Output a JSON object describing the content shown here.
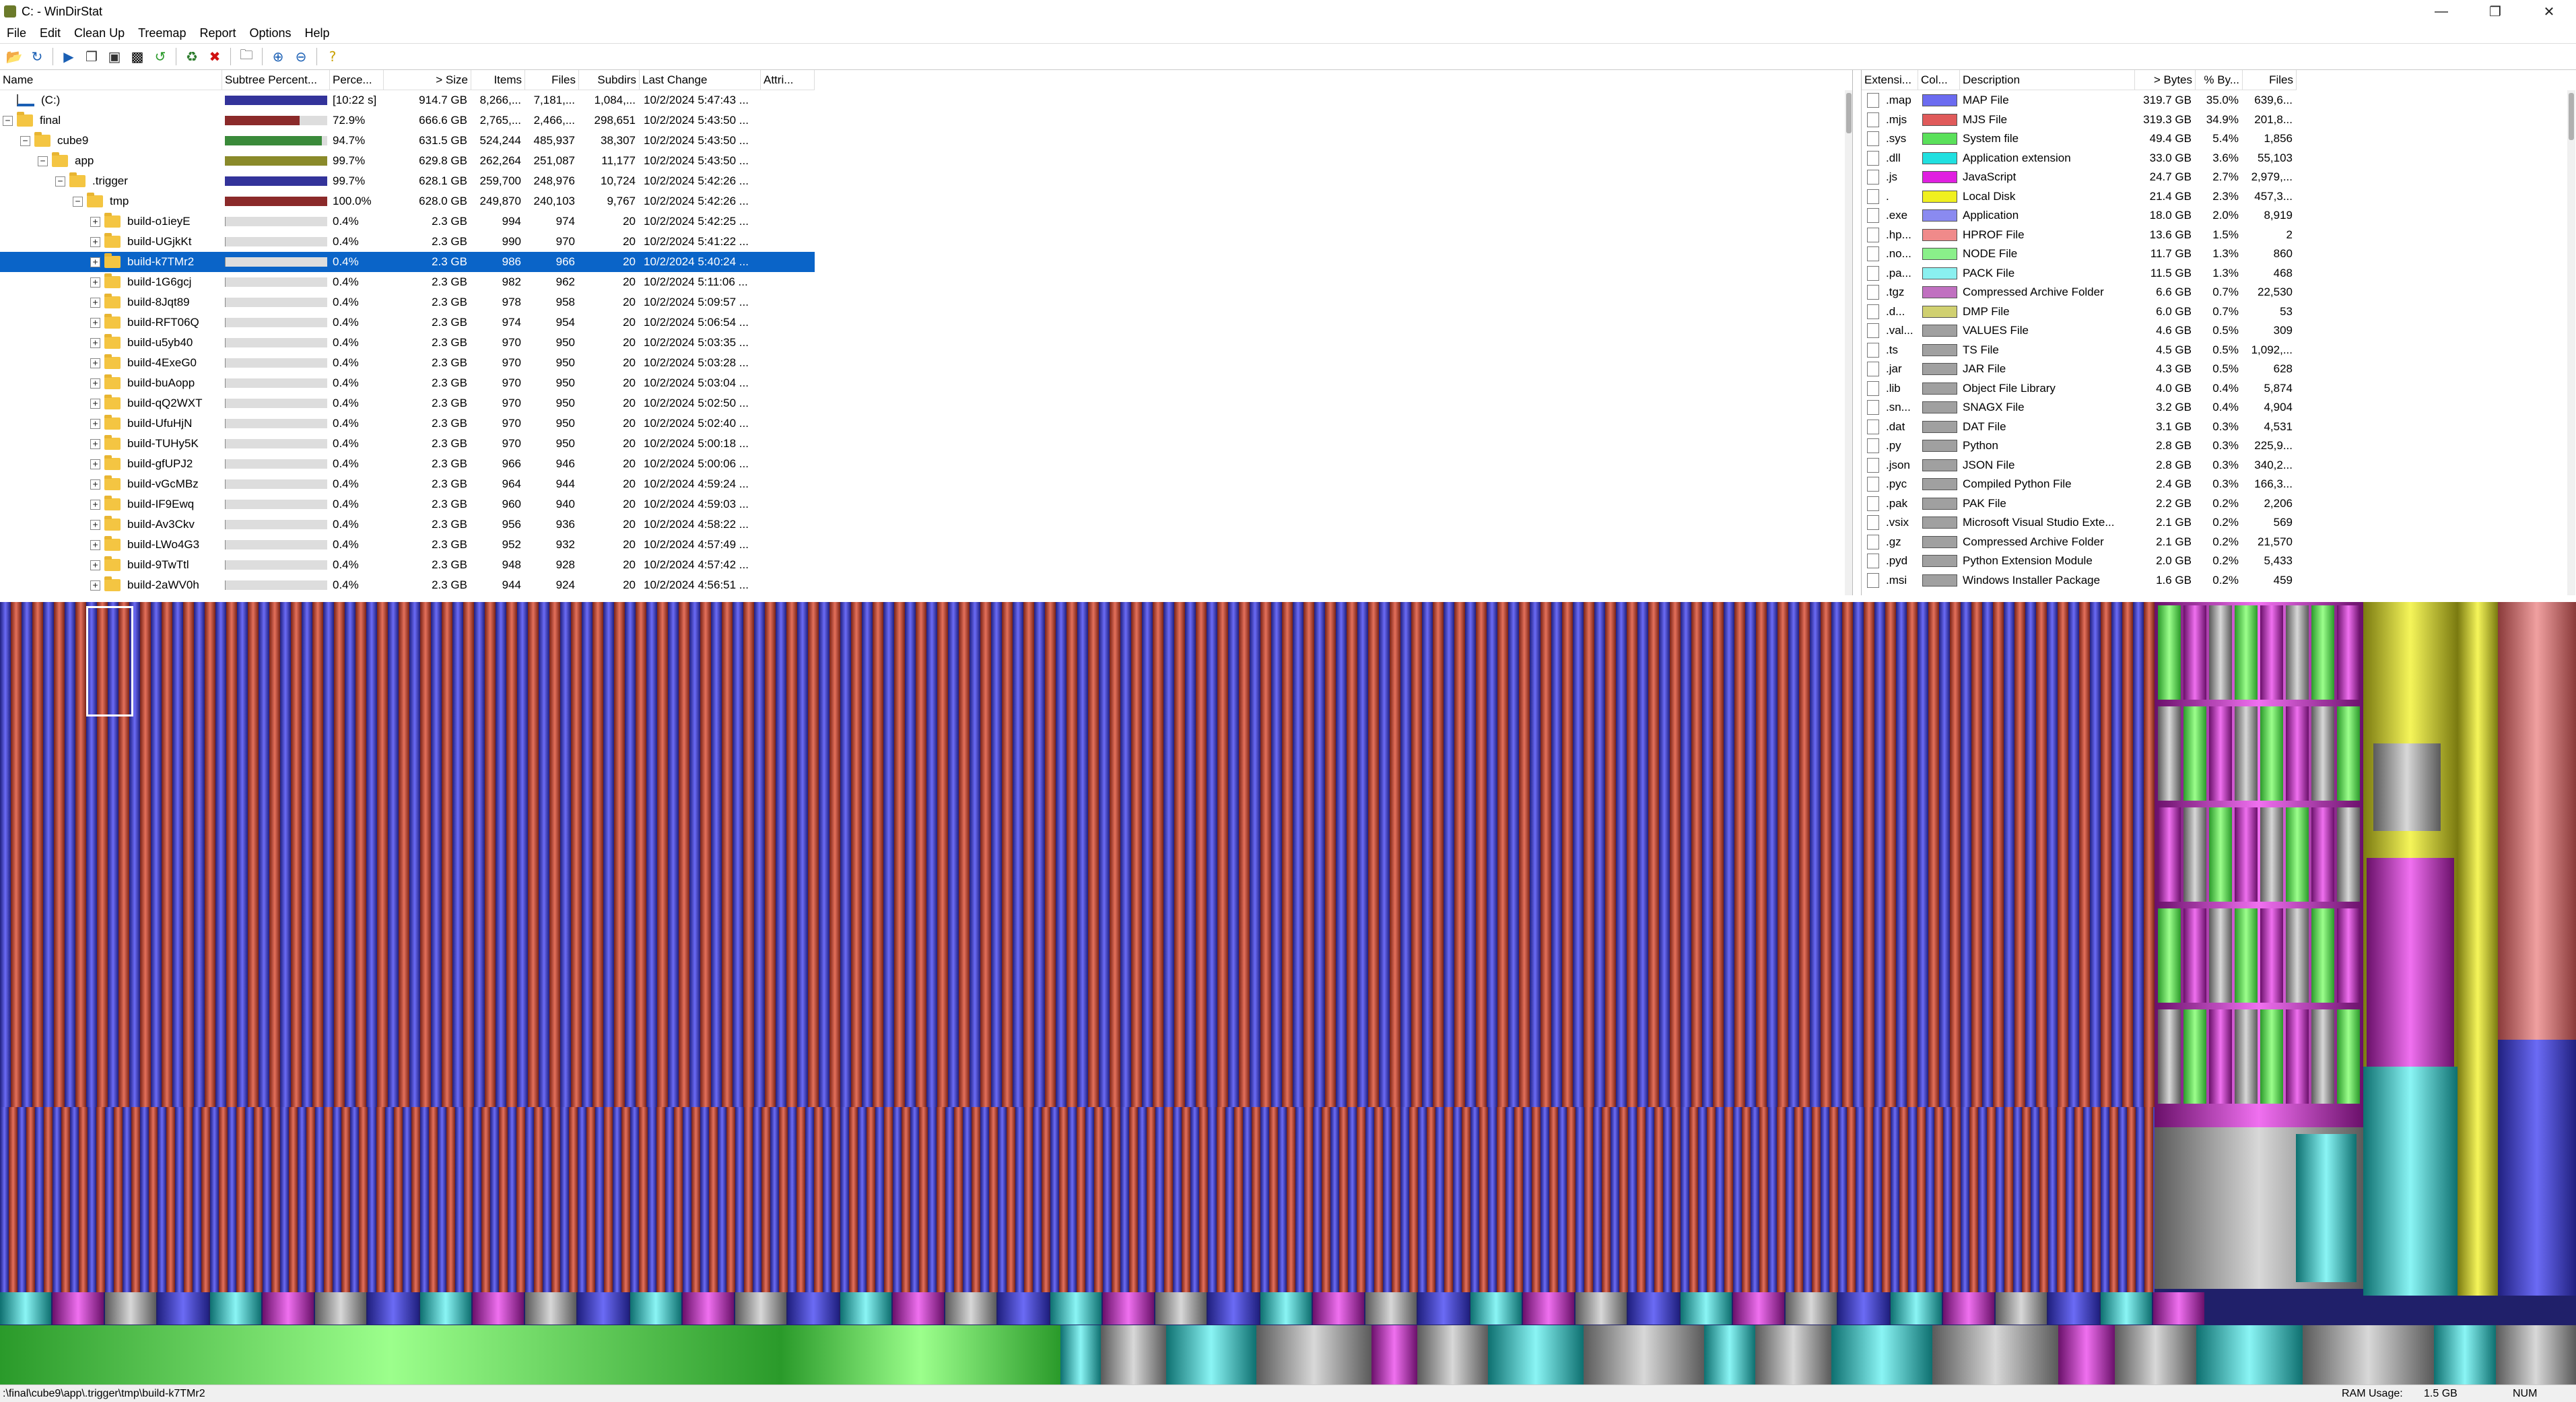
{
  "window": {
    "title": "C: - WinDirStat",
    "controls": {
      "minimize": "—",
      "maximize": "❐",
      "close": "✕"
    }
  },
  "menu": [
    "File",
    "Edit",
    "Clean Up",
    "Treemap",
    "Report",
    "Options",
    "Help"
  ],
  "toolbar": {
    "icons": [
      "open-icon",
      "refresh-icon",
      "play-icon",
      "copy-path-icon",
      "explorer-icon",
      "command-prompt-icon",
      "refresh-selected-icon",
      "recycle-icon",
      "delete-icon",
      "properties-icon",
      "zoom-in-icon",
      "zoom-out-icon",
      "help-icon"
    ]
  },
  "tree": {
    "columns": [
      "Name",
      "Subtree Percent...",
      "Perce...",
      "> Size",
      "Items",
      "Files",
      "Subdirs",
      "Last Change",
      "Attri..."
    ],
    "rows": [
      {
        "name": "(C:)",
        "level": 0,
        "icon": "drive",
        "exp": "",
        "pct": "[10:22 s]",
        "size": "914.7 GB",
        "items": "8,266,...",
        "files": "7,181,...",
        "subdirs": "1,084,...",
        "changed": "10/2/2024  5:47:43 ...",
        "bar": 1.0,
        "barcolor": "#33339a"
      },
      {
        "name": "final",
        "level": 0,
        "icon": "folder",
        "exp": "−",
        "pct": "72.9%",
        "size": "666.6 GB",
        "items": "2,765,...",
        "files": "2,466,...",
        "subdirs": "298,651",
        "changed": "10/2/2024  5:43:50 ...",
        "bar": 0.729,
        "barcolor": "#8b2a2a"
      },
      {
        "name": "cube9",
        "level": 1,
        "icon": "folder",
        "exp": "−",
        "pct": "94.7%",
        "size": "631.5 GB",
        "items": "524,244",
        "files": "485,937",
        "subdirs": "38,307",
        "changed": "10/2/2024  5:43:50 ...",
        "bar": 0.947,
        "barcolor": "#3a8a3a"
      },
      {
        "name": "app",
        "level": 2,
        "icon": "folder",
        "exp": "−",
        "pct": "99.7%",
        "size": "629.8 GB",
        "items": "262,264",
        "files": "251,087",
        "subdirs": "11,177",
        "changed": "10/2/2024  5:43:50 ...",
        "bar": 0.997,
        "barcolor": "#8a8a2a"
      },
      {
        "name": ".trigger",
        "level": 3,
        "icon": "folder",
        "exp": "−",
        "pct": "99.7%",
        "size": "628.1 GB",
        "items": "259,700",
        "files": "248,976",
        "subdirs": "10,724",
        "changed": "10/2/2024  5:42:26 ...",
        "bar": 0.997,
        "barcolor": "#33339a"
      },
      {
        "name": "tmp",
        "level": 4,
        "icon": "folder",
        "exp": "−",
        "pct": "100.0%",
        "size": "628.0 GB",
        "items": "249,870",
        "files": "240,103",
        "subdirs": "9,767",
        "changed": "10/2/2024  5:42:26 ...",
        "bar": 1.0,
        "barcolor": "#8b2a2a"
      },
      {
        "name": "build-o1ieyE",
        "level": 5,
        "icon": "folder",
        "exp": "+",
        "pct": "0.4%",
        "size": "2.3 GB",
        "items": "994",
        "files": "974",
        "subdirs": "20",
        "changed": "10/2/2024  5:42:25 ...",
        "bar": 0.004,
        "barcolor": "#888"
      },
      {
        "name": "build-UGjkKt",
        "level": 5,
        "icon": "folder",
        "exp": "+",
        "pct": "0.4%",
        "size": "2.3 GB",
        "items": "990",
        "files": "970",
        "subdirs": "20",
        "changed": "10/2/2024  5:41:22 ...",
        "bar": 0.004,
        "barcolor": "#888"
      },
      {
        "name": "build-k7TMr2",
        "level": 5,
        "icon": "folder",
        "exp": "+",
        "pct": "0.4%",
        "size": "2.3 GB",
        "items": "986",
        "files": "966",
        "subdirs": "20",
        "changed": "10/2/2024  5:40:24 ...",
        "bar": 0.004,
        "barcolor": "#888",
        "selected": true
      },
      {
        "name": "build-1G6gcj",
        "level": 5,
        "icon": "folder",
        "exp": "+",
        "pct": "0.4%",
        "size": "2.3 GB",
        "items": "982",
        "files": "962",
        "subdirs": "20",
        "changed": "10/2/2024  5:11:06 ...",
        "bar": 0.004,
        "barcolor": "#888"
      },
      {
        "name": "build-8Jqt89",
        "level": 5,
        "icon": "folder",
        "exp": "+",
        "pct": "0.4%",
        "size": "2.3 GB",
        "items": "978",
        "files": "958",
        "subdirs": "20",
        "changed": "10/2/2024  5:09:57 ...",
        "bar": 0.004,
        "barcolor": "#888"
      },
      {
        "name": "build-RFT06Q",
        "level": 5,
        "icon": "folder",
        "exp": "+",
        "pct": "0.4%",
        "size": "2.3 GB",
        "items": "974",
        "files": "954",
        "subdirs": "20",
        "changed": "10/2/2024  5:06:54 ...",
        "bar": 0.004,
        "barcolor": "#888"
      },
      {
        "name": "build-u5yb40",
        "level": 5,
        "icon": "folder",
        "exp": "+",
        "pct": "0.4%",
        "size": "2.3 GB",
        "items": "970",
        "files": "950",
        "subdirs": "20",
        "changed": "10/2/2024  5:03:35 ...",
        "bar": 0.004,
        "barcolor": "#888"
      },
      {
        "name": "build-4ExeG0",
        "level": 5,
        "icon": "folder",
        "exp": "+",
        "pct": "0.4%",
        "size": "2.3 GB",
        "items": "970",
        "files": "950",
        "subdirs": "20",
        "changed": "10/2/2024  5:03:28 ...",
        "bar": 0.004,
        "barcolor": "#888"
      },
      {
        "name": "build-buAopp",
        "level": 5,
        "icon": "folder",
        "exp": "+",
        "pct": "0.4%",
        "size": "2.3 GB",
        "items": "970",
        "files": "950",
        "subdirs": "20",
        "changed": "10/2/2024  5:03:04 ...",
        "bar": 0.004,
        "barcolor": "#888"
      },
      {
        "name": "build-qQ2WXT",
        "level": 5,
        "icon": "folder",
        "exp": "+",
        "pct": "0.4%",
        "size": "2.3 GB",
        "items": "970",
        "files": "950",
        "subdirs": "20",
        "changed": "10/2/2024  5:02:50 ...",
        "bar": 0.004,
        "barcolor": "#888"
      },
      {
        "name": "build-UfuHjN",
        "level": 5,
        "icon": "folder",
        "exp": "+",
        "pct": "0.4%",
        "size": "2.3 GB",
        "items": "970",
        "files": "950",
        "subdirs": "20",
        "changed": "10/2/2024  5:02:40 ...",
        "bar": 0.004,
        "barcolor": "#888"
      },
      {
        "name": "build-TUHy5K",
        "level": 5,
        "icon": "folder",
        "exp": "+",
        "pct": "0.4%",
        "size": "2.3 GB",
        "items": "970",
        "files": "950",
        "subdirs": "20",
        "changed": "10/2/2024  5:00:18 ...",
        "bar": 0.004,
        "barcolor": "#888"
      },
      {
        "name": "build-gfUPJ2",
        "level": 5,
        "icon": "folder",
        "exp": "+",
        "pct": "0.4%",
        "size": "2.3 GB",
        "items": "966",
        "files": "946",
        "subdirs": "20",
        "changed": "10/2/2024  5:00:06 ...",
        "bar": 0.004,
        "barcolor": "#888"
      },
      {
        "name": "build-vGcMBz",
        "level": 5,
        "icon": "folder",
        "exp": "+",
        "pct": "0.4%",
        "size": "2.3 GB",
        "items": "964",
        "files": "944",
        "subdirs": "20",
        "changed": "10/2/2024  4:59:24 ...",
        "bar": 0.004,
        "barcolor": "#888"
      },
      {
        "name": "build-IF9Ewq",
        "level": 5,
        "icon": "folder",
        "exp": "+",
        "pct": "0.4%",
        "size": "2.3 GB",
        "items": "960",
        "files": "940",
        "subdirs": "20",
        "changed": "10/2/2024  4:59:03 ...",
        "bar": 0.004,
        "barcolor": "#888"
      },
      {
        "name": "build-Av3Ckv",
        "level": 5,
        "icon": "folder",
        "exp": "+",
        "pct": "0.4%",
        "size": "2.3 GB",
        "items": "956",
        "files": "936",
        "subdirs": "20",
        "changed": "10/2/2024  4:58:22 ...",
        "bar": 0.004,
        "barcolor": "#888"
      },
      {
        "name": "build-LWo4G3",
        "level": 5,
        "icon": "folder",
        "exp": "+",
        "pct": "0.4%",
        "size": "2.3 GB",
        "items": "952",
        "files": "932",
        "subdirs": "20",
        "changed": "10/2/2024  4:57:49 ...",
        "bar": 0.004,
        "barcolor": "#888"
      },
      {
        "name": "build-9TwTtl",
        "level": 5,
        "icon": "folder",
        "exp": "+",
        "pct": "0.4%",
        "size": "2.3 GB",
        "items": "948",
        "files": "928",
        "subdirs": "20",
        "changed": "10/2/2024  4:57:42 ...",
        "bar": 0.004,
        "barcolor": "#888"
      },
      {
        "name": "build-2aWV0h",
        "level": 5,
        "icon": "folder",
        "exp": "+",
        "pct": "0.4%",
        "size": "2.3 GB",
        "items": "944",
        "files": "924",
        "subdirs": "20",
        "changed": "10/2/2024  4:56:51 ...",
        "bar": 0.004,
        "barcolor": "#888"
      }
    ]
  },
  "extensions": {
    "columns": [
      "Extensi...",
      "Col...",
      "Description",
      "> Bytes",
      "% By...",
      "Files"
    ],
    "rows": [
      {
        "ext": ".map",
        "color": "#6b6bf0",
        "desc": "MAP File",
        "bytes": "319.7 GB",
        "pct": "35.0%",
        "files": "639,6..."
      },
      {
        "ext": ".mjs",
        "color": "#e05a5a",
        "desc": "MJS File",
        "bytes": "319.3 GB",
        "pct": "34.9%",
        "files": "201,8..."
      },
      {
        "ext": ".sys",
        "color": "#5ae05a",
        "desc": "System file",
        "bytes": "49.4 GB",
        "pct": "5.4%",
        "files": "1,856"
      },
      {
        "ext": ".dll",
        "color": "#20e0e0",
        "desc": "Application extension",
        "bytes": "33.0 GB",
        "pct": "3.6%",
        "files": "55,103"
      },
      {
        "ext": ".js",
        "color": "#e020e0",
        "desc": "JavaScript",
        "bytes": "24.7 GB",
        "pct": "2.7%",
        "files": "2,979,..."
      },
      {
        "ext": ".",
        "color": "#f0f020",
        "desc": "Local Disk",
        "bytes": "21.4 GB",
        "pct": "2.3%",
        "files": "457,3..."
      },
      {
        "ext": ".exe",
        "color": "#8a8af0",
        "desc": "Application",
        "bytes": "18.0 GB",
        "pct": "2.0%",
        "files": "8,919"
      },
      {
        "ext": ".hp...",
        "color": "#f08a8a",
        "desc": "HPROF File",
        "bytes": "13.6 GB",
        "pct": "1.5%",
        "files": "2"
      },
      {
        "ext": ".no...",
        "color": "#8af08a",
        "desc": "NODE File",
        "bytes": "11.7 GB",
        "pct": "1.3%",
        "files": "860"
      },
      {
        "ext": ".pa...",
        "color": "#8af0f0",
        "desc": "PACK File",
        "bytes": "11.5 GB",
        "pct": "1.3%",
        "files": "468"
      },
      {
        "ext": ".tgz",
        "color": "#c070c0",
        "desc": "Compressed Archive Folder",
        "bytes": "6.6 GB",
        "pct": "0.7%",
        "files": "22,530"
      },
      {
        "ext": ".d...",
        "color": "#d0d070",
        "desc": "DMP File",
        "bytes": "6.0 GB",
        "pct": "0.7%",
        "files": "53"
      },
      {
        "ext": ".val...",
        "color": "#a0a0a0",
        "desc": "VALUES File",
        "bytes": "4.6 GB",
        "pct": "0.5%",
        "files": "309"
      },
      {
        "ext": ".ts",
        "color": "#a0a0a0",
        "desc": "TS File",
        "bytes": "4.5 GB",
        "pct": "0.5%",
        "files": "1,092,..."
      },
      {
        "ext": ".jar",
        "color": "#a0a0a0",
        "desc": "JAR File",
        "bytes": "4.3 GB",
        "pct": "0.5%",
        "files": "628"
      },
      {
        "ext": ".lib",
        "color": "#a0a0a0",
        "desc": "Object File Library",
        "bytes": "4.0 GB",
        "pct": "0.4%",
        "files": "5,874"
      },
      {
        "ext": ".sn...",
        "color": "#a0a0a0",
        "desc": "SNAGX File",
        "bytes": "3.2 GB",
        "pct": "0.4%",
        "files": "4,904"
      },
      {
        "ext": ".dat",
        "color": "#a0a0a0",
        "desc": "DAT File",
        "bytes": "3.1 GB",
        "pct": "0.3%",
        "files": "4,531"
      },
      {
        "ext": ".py",
        "color": "#a0a0a0",
        "desc": "Python",
        "bytes": "2.8 GB",
        "pct": "0.3%",
        "files": "225,9..."
      },
      {
        "ext": ".json",
        "color": "#a0a0a0",
        "desc": "JSON File",
        "bytes": "2.8 GB",
        "pct": "0.3%",
        "files": "340,2..."
      },
      {
        "ext": ".pyc",
        "color": "#a0a0a0",
        "desc": "Compiled Python File",
        "bytes": "2.4 GB",
        "pct": "0.3%",
        "files": "166,3..."
      },
      {
        "ext": ".pak",
        "color": "#a0a0a0",
        "desc": "PAK File",
        "bytes": "2.2 GB",
        "pct": "0.2%",
        "files": "2,206"
      },
      {
        "ext": ".vsix",
        "color": "#a0a0a0",
        "desc": "Microsoft Visual Studio Exte...",
        "bytes": "2.1 GB",
        "pct": "0.2%",
        "files": "569"
      },
      {
        "ext": ".gz",
        "color": "#a0a0a0",
        "desc": "Compressed Archive Folder",
        "bytes": "2.1 GB",
        "pct": "0.2%",
        "files": "21,570"
      },
      {
        "ext": ".pyd",
        "color": "#a0a0a0",
        "desc": "Python Extension Module",
        "bytes": "2.0 GB",
        "pct": "0.2%",
        "files": "5,433"
      },
      {
        "ext": ".msi",
        "color": "#a0a0a0",
        "desc": "Windows Installer Package",
        "bytes": "1.6 GB",
        "pct": "0.2%",
        "files": "459"
      }
    ]
  },
  "treemap": {
    "selected_path": "C:\\final\\cube9\\app\\.trigger\\tmp\\build-k7TMr2"
  },
  "status": {
    "path": ":\\final\\cube9\\app\\.trigger\\tmp\\build-k7TMr2",
    "ram_label": "RAM Usage:",
    "ram_value": "1.5 GB",
    "num": "NUM"
  }
}
